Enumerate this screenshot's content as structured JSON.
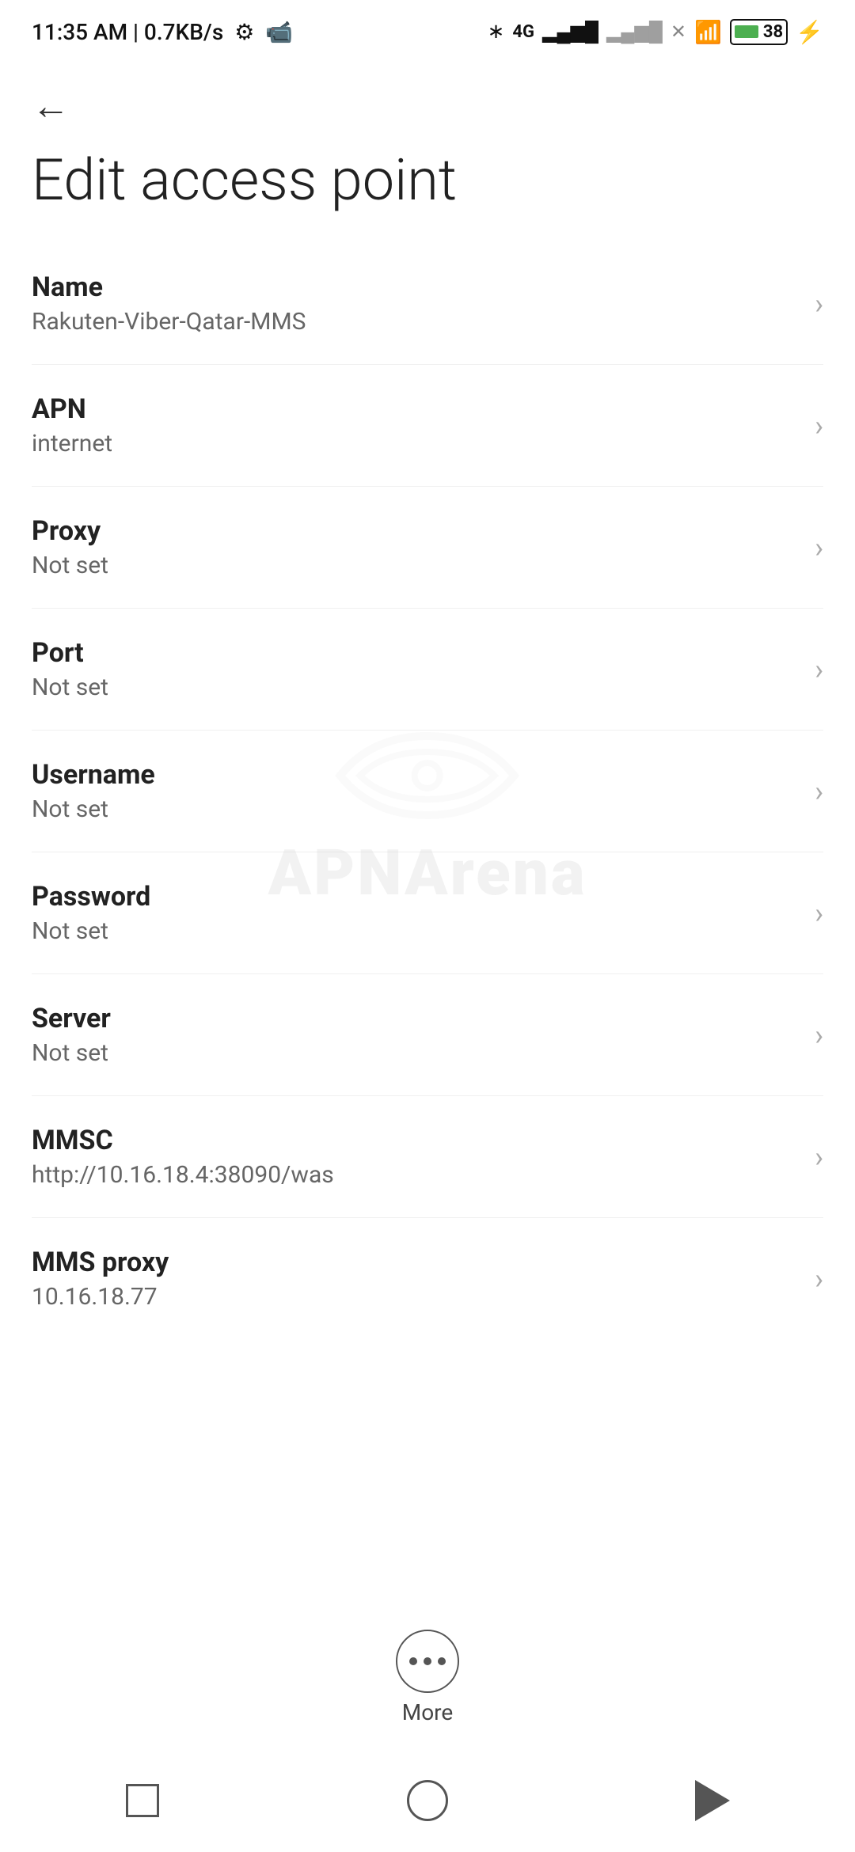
{
  "statusBar": {
    "time": "11:35 AM | 0.7KB/s",
    "battery": "38"
  },
  "header": {
    "backLabel": "←",
    "title": "Edit access point"
  },
  "moreButton": {
    "label": "More"
  },
  "settings": [
    {
      "id": "name",
      "label": "Name",
      "value": "Rakuten-Viber-Qatar-MMS"
    },
    {
      "id": "apn",
      "label": "APN",
      "value": "internet"
    },
    {
      "id": "proxy",
      "label": "Proxy",
      "value": "Not set"
    },
    {
      "id": "port",
      "label": "Port",
      "value": "Not set"
    },
    {
      "id": "username",
      "label": "Username",
      "value": "Not set"
    },
    {
      "id": "password",
      "label": "Password",
      "value": "Not set"
    },
    {
      "id": "server",
      "label": "Server",
      "value": "Not set"
    },
    {
      "id": "mmsc",
      "label": "MMSC",
      "value": "http://10.16.18.4:38090/was"
    },
    {
      "id": "mms-proxy",
      "label": "MMS proxy",
      "value": "10.16.18.77"
    }
  ]
}
